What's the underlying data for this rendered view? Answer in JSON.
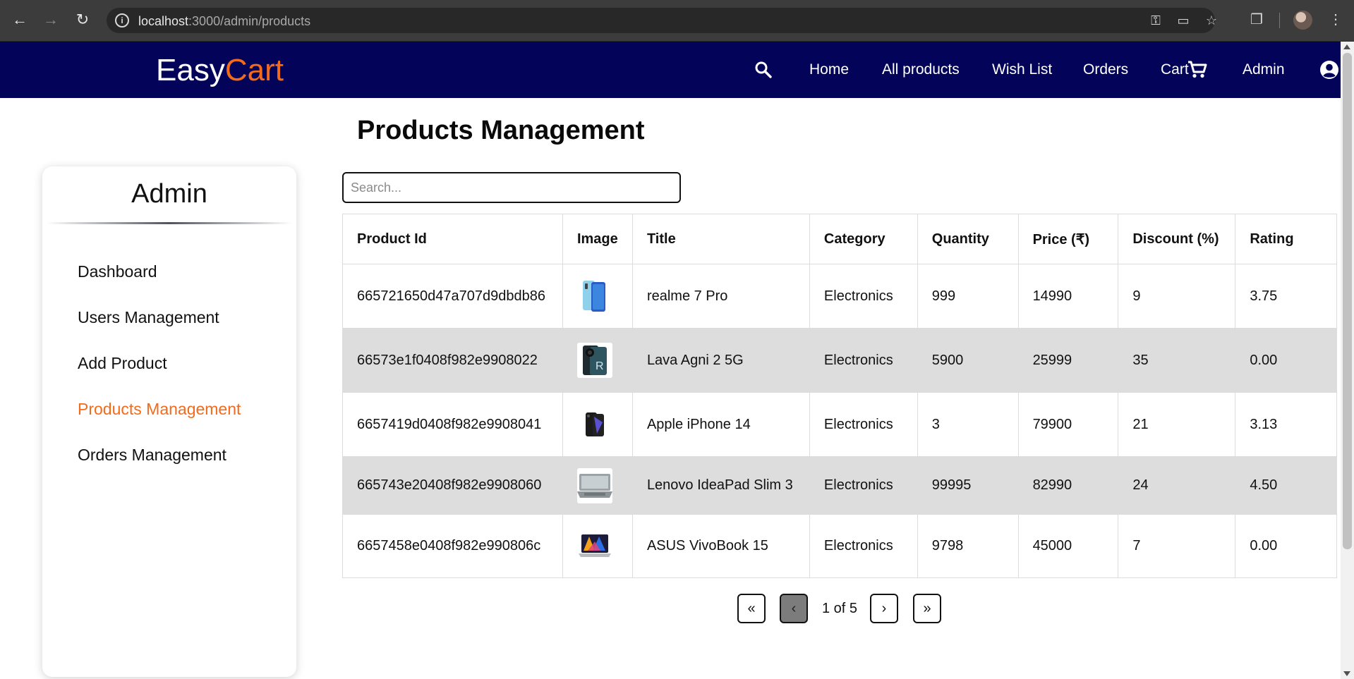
{
  "browser": {
    "url_host": "localhost",
    "url_path": ":3000/admin/products"
  },
  "header": {
    "logo_main": "Easy",
    "logo_accent": "Cart",
    "nav": [
      "Home",
      "All products",
      "Wish List",
      "Orders",
      "Cart",
      "Admin"
    ],
    "accent_color": "#f26b1d",
    "bg_color": "#030459"
  },
  "sidebar": {
    "title": "Admin",
    "items": [
      {
        "label": "Dashboard",
        "active": false
      },
      {
        "label": "Users Management",
        "active": false
      },
      {
        "label": "Add Product",
        "active": false
      },
      {
        "label": "Products Management",
        "active": true
      },
      {
        "label": "Orders Management",
        "active": false
      }
    ]
  },
  "main": {
    "title": "Products Management",
    "search_placeholder": "Search...",
    "columns": [
      "Product Id",
      "Image",
      "Title",
      "Category",
      "Quantity",
      "Price (₹)",
      "Discount (%)",
      "Rating"
    ],
    "rows": [
      {
        "id": "665721650d47a707d9dbdb86",
        "image": "phone-blue",
        "title": "realme 7 Pro",
        "category": "Electronics",
        "quantity": "999",
        "price": "14990",
        "discount": "9",
        "rating": "3.75"
      },
      {
        "id": "66573e1f0408f982e9908022",
        "image": "phone-dark",
        "title": "Lava Agni 2 5G",
        "category": "Electronics",
        "quantity": "5900",
        "price": "25999",
        "discount": "35",
        "rating": "0.00"
      },
      {
        "id": "6657419d0408f982e9908041",
        "image": "phone-black",
        "title": "Apple iPhone 14",
        "category": "Electronics",
        "quantity": "3",
        "price": "79900",
        "discount": "21",
        "rating": "3.13"
      },
      {
        "id": "665743e20408f982e9908060",
        "image": "laptop-gray",
        "title": "Lenovo IdeaPad Slim 3",
        "category": "Electronics",
        "quantity": "99995",
        "price": "82990",
        "discount": "24",
        "rating": "4.50"
      },
      {
        "id": "6657458e0408f982e990806c",
        "image": "laptop-colorful",
        "title": "ASUS VivoBook 15",
        "category": "Electronics",
        "quantity": "9798",
        "price": "45000",
        "discount": "7",
        "rating": "0.00"
      }
    ]
  },
  "pagination": {
    "first": "«",
    "prev": "‹",
    "label": "1 of 5",
    "next": "›",
    "last": "»"
  }
}
